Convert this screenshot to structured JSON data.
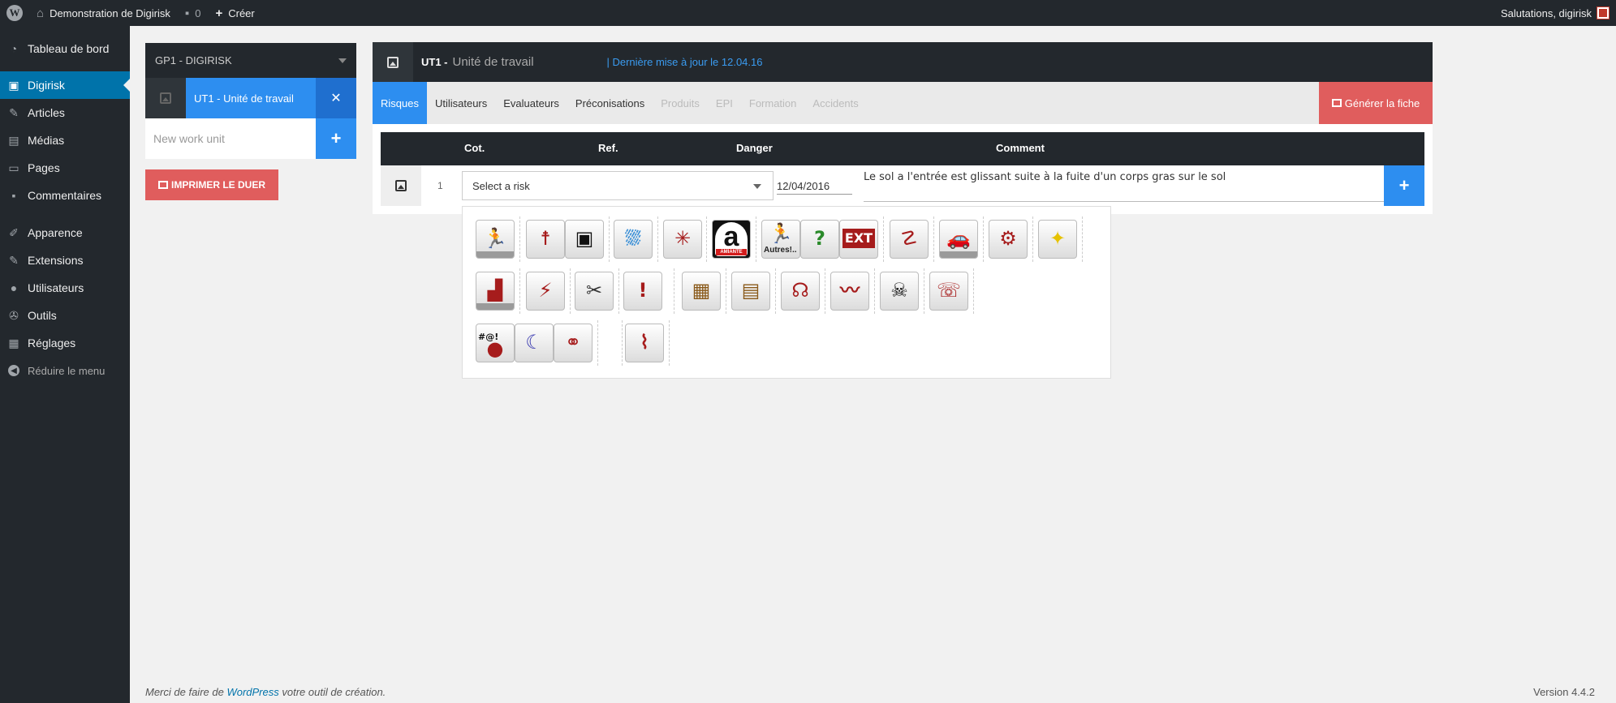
{
  "adminbar": {
    "site_name": "Demonstration de Digirisk",
    "comments_count": "0",
    "new_label": "Créer",
    "greeting": "Salutations, digirisk"
  },
  "sidebar": {
    "items": [
      {
        "label": "Tableau de bord",
        "icon": "dashboard-icon"
      },
      {
        "label": "Digirisk",
        "icon": "digirisk-icon"
      },
      {
        "label": "Articles",
        "icon": "pin-icon"
      },
      {
        "label": "Médias",
        "icon": "media-icon"
      },
      {
        "label": "Pages",
        "icon": "pages-icon"
      },
      {
        "label": "Commentaires",
        "icon": "comments-icon"
      },
      {
        "label": "Apparence",
        "icon": "brush-icon"
      },
      {
        "label": "Extensions",
        "icon": "plugin-icon"
      },
      {
        "label": "Utilisateurs",
        "icon": "users-icon"
      },
      {
        "label": "Outils",
        "icon": "wrench-icon"
      },
      {
        "label": "Réglages",
        "icon": "settings-icon"
      }
    ],
    "collapse_label": "Réduire le menu"
  },
  "leftpanel": {
    "group_label": "GP1 - DIGIRISK",
    "ut_ref": "UT1 -",
    "ut_name": "Unité de travail",
    "new_placeholder": "New work unit",
    "print_label": "IMPRIMER LE DUER"
  },
  "main": {
    "ref": "UT1 -",
    "name": "Unité de travail",
    "update": "| Dernière mise à jour le 12.04.16",
    "tabs": [
      {
        "label": "Risques",
        "state": "active"
      },
      {
        "label": "Utilisateurs",
        "state": "normal"
      },
      {
        "label": "Evaluateurs",
        "state": "normal"
      },
      {
        "label": "Préconisations",
        "state": "normal"
      },
      {
        "label": "Produits",
        "state": "disabled"
      },
      {
        "label": "EPI",
        "state": "disabled"
      },
      {
        "label": "Formation",
        "state": "disabled"
      },
      {
        "label": "Accidents",
        "state": "disabled"
      }
    ],
    "generate_label": "Générer la fiche",
    "table": {
      "headers": {
        "cot": "Cot.",
        "ref": "Ref.",
        "danger": "Danger",
        "comment": "Comment"
      },
      "row": {
        "number": "1",
        "select_placeholder": "Select a risk",
        "date": "12/04/2016",
        "comment": "Le sol a l'entrée est glissant suite à la fuite d'un corps gras sur le sol"
      }
    }
  },
  "risk_icons": [
    {
      "name": "chute-plain-pied-icon",
      "glyph": "🏃"
    },
    {
      "name": "activite-physique-icon",
      "glyph": "☨"
    },
    {
      "name": "travail-ecran-icon",
      "glyph": "▣"
    },
    {
      "name": "douche-icon",
      "glyph": "⛆"
    },
    {
      "name": "rayonnement-icon",
      "glyph": "✳"
    },
    {
      "name": "amiante-icon",
      "glyph": "a",
      "label": "AMIANTE"
    },
    {
      "name": "autres-icon",
      "glyph": "🏃",
      "text": "Autres!.."
    },
    {
      "name": "inconnu-icon",
      "glyph": "?"
    },
    {
      "name": "exterieur-icon",
      "glyph": "EXT"
    },
    {
      "name": "chute-hauteur-icon",
      "glyph": "☡"
    },
    {
      "name": "circulation-icon",
      "glyph": "🚗"
    },
    {
      "name": "manutention-mecanique-icon",
      "glyph": "⚙"
    },
    {
      "name": "eclairage-icon",
      "glyph": "✦"
    },
    {
      "name": "effondrement-icon",
      "glyph": "▟"
    },
    {
      "name": "electricite-icon",
      "glyph": "⚡"
    },
    {
      "name": "outils-icon",
      "glyph": "✂"
    },
    {
      "name": "incendie-icon",
      "glyph": "!"
    },
    {
      "name": "manutention-manuelle-icon",
      "glyph": "▦"
    },
    {
      "name": "stockage-icon",
      "glyph": "▤"
    },
    {
      "name": "bruit-icon",
      "glyph": "☊"
    },
    {
      "name": "nettoyage-icon",
      "glyph": "〰"
    },
    {
      "name": "toxique-icon",
      "glyph": "☠"
    },
    {
      "name": "ondes-icon",
      "glyph": "☏"
    },
    {
      "name": "psychosocial-icon",
      "glyph": "#@!"
    },
    {
      "name": "travail-nuit-icon",
      "glyph": "☾"
    },
    {
      "name": "relations-icon",
      "glyph": "⚭"
    },
    {
      "name": "vibrations-icon",
      "glyph": "⌇"
    }
  ],
  "footer": {
    "prefix": "Merci de faire de",
    "link": "WordPress",
    "suffix": "votre outil de création.",
    "version": "Version 4.4.2"
  },
  "colors": {
    "accent_blue": "#2d8ef0",
    "danger_red": "#e05d5d",
    "admin_dark": "#23282d",
    "wp_active": "#0073aa"
  }
}
